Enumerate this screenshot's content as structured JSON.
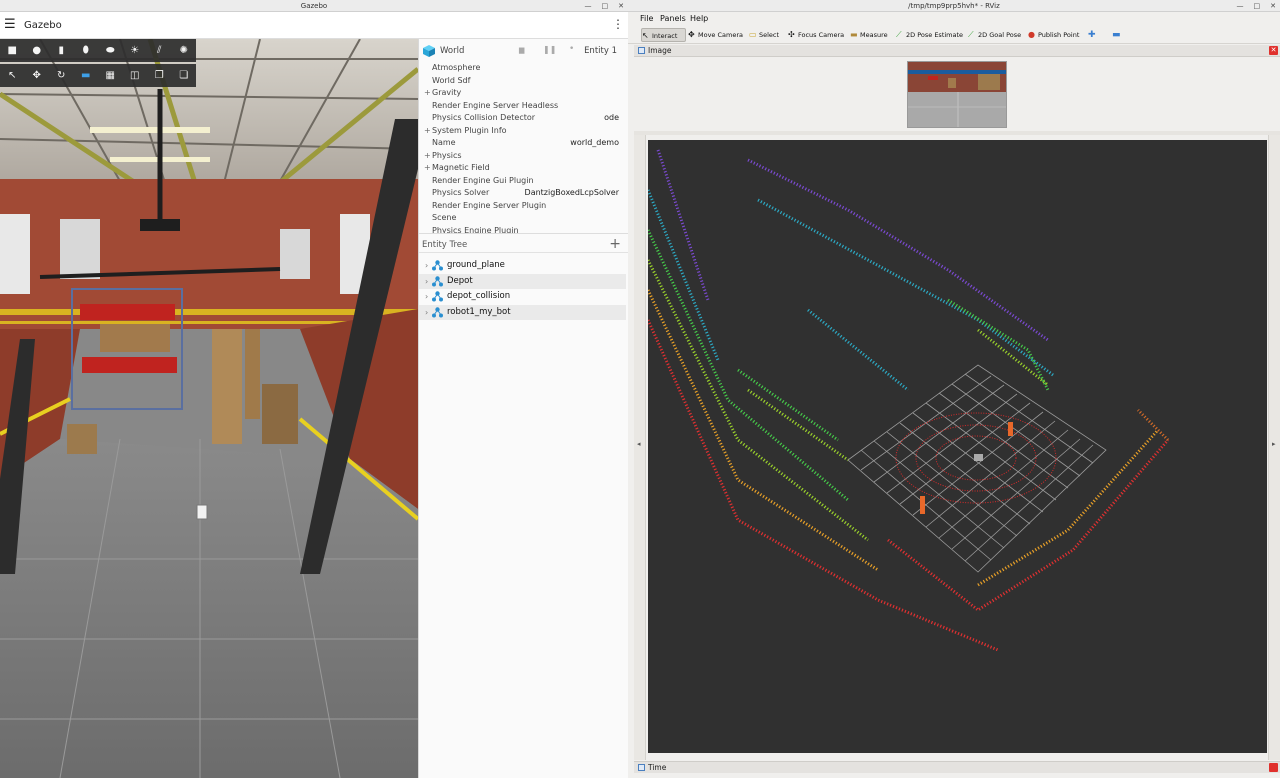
{
  "gazebo": {
    "window_title": "Gazebo",
    "app_title": "Gazebo",
    "window_controls": [
      "—",
      "□",
      "✕"
    ],
    "toolbar_top": [
      "box-icon",
      "sphere-icon",
      "cylinder-icon",
      "capsule-icon",
      "ellipsoid-icon",
      "sun-icon",
      "lines-icon",
      "spot-icon"
    ],
    "toolbar_bottom": [
      "select-icon",
      "translate-icon",
      "rotate-icon",
      "grid-snap-icon",
      "grid-icon",
      "camera-icon",
      "copy-icon",
      "paste-icon"
    ],
    "component_inspector": {
      "title": "World",
      "entity": "Entity 1",
      "rows": [
        {
          "plus": "",
          "label": "Atmosphere",
          "value": ""
        },
        {
          "plus": "",
          "label": "World Sdf",
          "value": ""
        },
        {
          "plus": "+",
          "label": "Gravity",
          "value": ""
        },
        {
          "plus": "",
          "label": "Render Engine Server Headless",
          "value": ""
        },
        {
          "plus": "",
          "label": "Physics Collision Detector",
          "value": "ode"
        },
        {
          "plus": "+",
          "label": "System Plugin Info",
          "value": ""
        },
        {
          "plus": "",
          "label": "Name",
          "value": "world_demo"
        },
        {
          "plus": "+",
          "label": "Physics",
          "value": ""
        },
        {
          "plus": "+",
          "label": "Magnetic Field",
          "value": ""
        },
        {
          "plus": "",
          "label": "Render Engine Gui Plugin",
          "value": ""
        },
        {
          "plus": "",
          "label": "Physics Solver",
          "value": "DantzigBoxedLcpSolver"
        },
        {
          "plus": "",
          "label": "Render Engine Server Plugin",
          "value": ""
        },
        {
          "plus": "",
          "label": "Scene",
          "value": ""
        },
        {
          "plus": "",
          "label": "Physics Engine Plugin",
          "value": ""
        }
      ]
    },
    "entity_tree": {
      "title": "Entity Tree",
      "add": "+",
      "items": [
        {
          "label": "ground_plane"
        },
        {
          "label": "Depot"
        },
        {
          "label": "depot_collision"
        },
        {
          "label": "robot1_my_bot"
        }
      ]
    }
  },
  "rviz": {
    "window_title": "/tmp/tmp9prp5hvh* - RViz",
    "window_controls": [
      "—",
      "□",
      "✕"
    ],
    "menu": [
      "File",
      "Panels",
      "Help"
    ],
    "tools": [
      {
        "label": "Interact",
        "icon": "cursor-icon",
        "active": true
      },
      {
        "label": "Move Camera",
        "icon": "move-camera-icon",
        "active": false
      },
      {
        "label": "Select",
        "icon": "select-box-icon",
        "active": false
      },
      {
        "label": "Focus Camera",
        "icon": "focus-camera-icon",
        "active": false
      },
      {
        "label": "Measure",
        "icon": "ruler-icon",
        "active": false
      },
      {
        "label": "2D Pose Estimate",
        "icon": "pose-estimate-icon",
        "active": false
      },
      {
        "label": "2D Goal Pose",
        "icon": "goal-pose-icon",
        "active": false
      },
      {
        "label": "Publish Point",
        "icon": "map-pin-icon",
        "active": false
      }
    ],
    "image_panel_title": "Image",
    "time_panel_title": "Time"
  }
}
